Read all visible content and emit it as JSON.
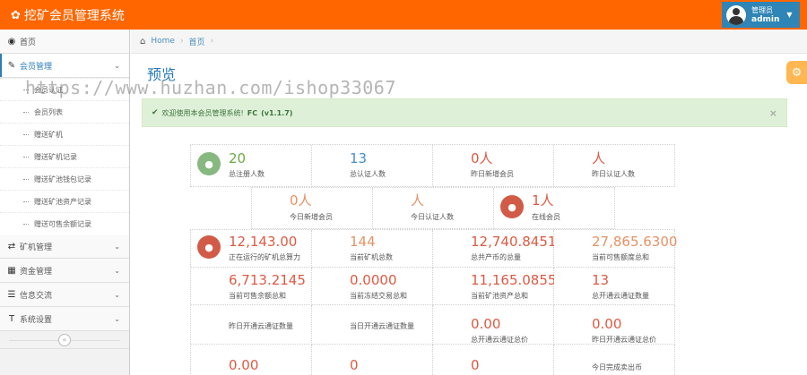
{
  "app": {
    "title": "挖矿会员管理系统"
  },
  "user": {
    "role": "管理员",
    "name": "admin"
  },
  "sidebar": {
    "items": [
      {
        "label": "首页",
        "icon": "dashboard-icon"
      },
      {
        "label": "会员管理",
        "icon": "edit-icon",
        "active": true,
        "children": [
          "会员认证",
          "会员列表",
          "赠送矿机",
          "赠送矿机记录",
          "赠送矿池钱包记录",
          "赠送矿池资产记录",
          "赠送可售余额记录"
        ]
      },
      {
        "label": "矿机管理",
        "icon": "shuffle-icon"
      },
      {
        "label": "资金管理",
        "icon": "calendar-icon"
      },
      {
        "label": "信息交流",
        "icon": "list-icon"
      },
      {
        "label": "系统设置",
        "icon": "text-icon"
      }
    ]
  },
  "breadcrumb": {
    "home": "Home",
    "current": "首页"
  },
  "page": {
    "title": "预览"
  },
  "watermark": "https://www.huzhan.com/ishop33067",
  "alert": {
    "text": "欢迎使用本会员管理系统!",
    "brand": "FC",
    "version": "(v1.1.7)",
    "close": "×"
  },
  "stats_row1": [
    {
      "value": "20",
      "label": "总注册人数"
    },
    {
      "value": "13",
      "label": "总认证人数"
    },
    {
      "value": "0人",
      "label": "昨日新增会员"
    },
    {
      "value": "人",
      "label": "昨日认证人数"
    }
  ],
  "stats_row2": [
    {
      "value": "0人",
      "label": "今日新增会员"
    },
    {
      "value": "人",
      "label": "今日认证人数"
    },
    {
      "value": "1人",
      "label": "在线会员"
    }
  ],
  "stats_row3": [
    {
      "value": "12,143.00",
      "label": "正在运行的矿机总算力"
    },
    {
      "value": "144",
      "label": "当前矿机总数"
    },
    {
      "value": "12,740.8451",
      "label": "总共产币的总量"
    },
    {
      "value": "27,865.6300",
      "label": "当前可售额度总和"
    },
    {
      "value": "6,713.2145",
      "label": "当前可售余额总和"
    },
    {
      "value": "0.0000",
      "label": "当前冻结交易总和"
    },
    {
      "value": "11,165.0855",
      "label": "当前矿池资产总和"
    },
    {
      "value": "13",
      "label": "总开通云通证数量"
    },
    {
      "value": "",
      "label": "昨日开通云通证数量"
    },
    {
      "value": "",
      "label": "当日开通云通证数量"
    },
    {
      "value": "0.00",
      "label": "总开通云通证总价"
    },
    {
      "value": "0.00",
      "label": "昨日开通云通证总价"
    },
    {
      "value": "0.00",
      "label": ""
    },
    {
      "value": "0",
      "label": ""
    },
    {
      "value": "0",
      "label": ""
    },
    {
      "value": "",
      "label": "今日完成卖出币"
    }
  ],
  "colors": {
    "navbar": "#ff6600",
    "user_box": "#2f85b5",
    "accent": "#2679b5",
    "alert_bg": "#dff0d8",
    "settings": "#ffb752"
  }
}
